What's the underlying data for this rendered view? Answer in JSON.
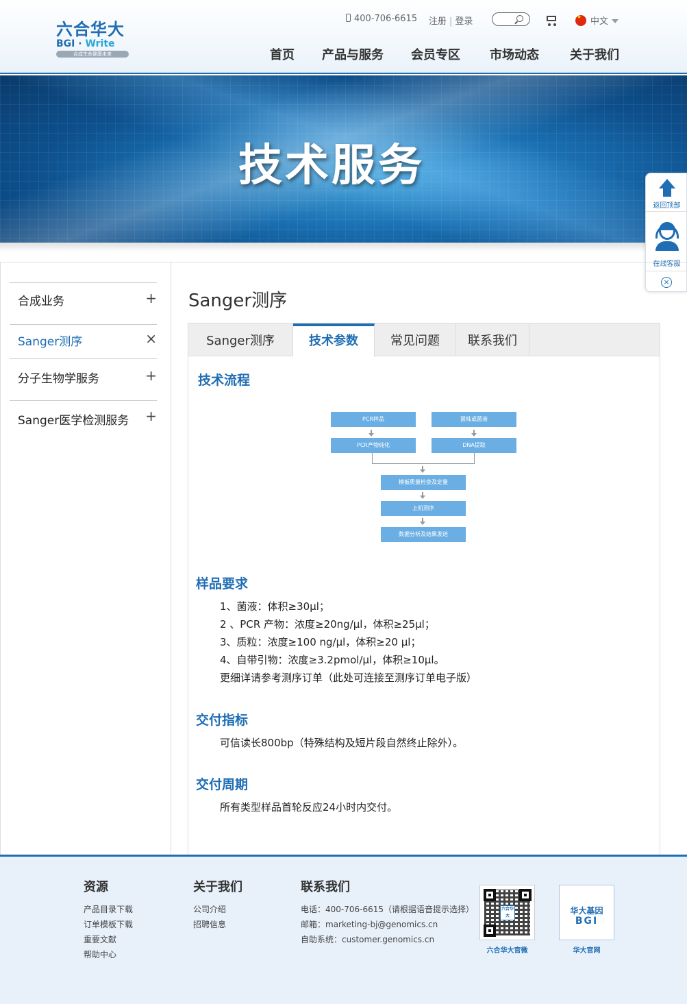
{
  "header": {
    "logo_cn": "六合华大",
    "logo_en_main": "BGI",
    "logo_en_write": "Write",
    "logo_tagline": "合成生命健康未来",
    "phone": "400-706-6615",
    "register": "注册",
    "login": "登录",
    "lang": "中文",
    "nav": [
      "首页",
      "产品与服务",
      "会员专区",
      "市场动态",
      "关于我们"
    ]
  },
  "banner": {
    "title": "技术服务"
  },
  "float_panel": {
    "back_top": "返回顶部",
    "online_service": "在线客服"
  },
  "sidebar": {
    "items": [
      {
        "label": "合成业务",
        "sign": "+"
      },
      {
        "label": "Sanger测序",
        "sign": "×",
        "active": true
      },
      {
        "label": "分子生物学服务",
        "sign": "+"
      },
      {
        "label": "Sanger医学检测服务",
        "sign": "+"
      }
    ]
  },
  "main": {
    "page_title": "Sanger测序",
    "tabs": [
      "Sanger测序",
      "技术参数",
      "常见问题",
      "联系我们"
    ],
    "active_tab": "技术参数",
    "sections": {
      "process_title": "技术流程",
      "flow": {
        "left_1": "PCR样品",
        "left_2": "PCR产物纯化",
        "right_1": "菌株或菌液",
        "right_2": "DNA提取",
        "step_1": "模板质量检查及定量",
        "step_2": "上机测序",
        "step_3": "数据分析及结果发送"
      },
      "sample_title": "样品要求",
      "sample_lines": [
        "1、菌液：体积≥30μl；",
        "2 、PCR 产物：浓度≥20ng/μl，体积≥25μl；",
        "3、质粒：浓度≥100 ng/μl，体积≥20 μl；",
        "4、自带引物：浓度≥3.2pmol/μl，体积≥10μl。",
        "更细详请参考测序订单（此处可连接至测序订单电子版）"
      ],
      "delivery_title": "交付指标",
      "delivery_text": "可信读长800bp（特殊结构及短片段自然终止除外）。",
      "cycle_title": "交付周期",
      "cycle_text": "所有类型样品首轮反应24小时内交付。"
    }
  },
  "footer": {
    "resources": {
      "title": "资源",
      "links": [
        "产品目录下载",
        "订单模板下载",
        "重要文献",
        "帮助中心"
      ]
    },
    "about": {
      "title": "关于我们",
      "links": [
        "公司介绍",
        "招聘信息"
      ]
    },
    "contact": {
      "title": "联系我们",
      "lines": [
        "电话：400-706-6615（请根据语音提示选择）",
        "邮箱：marketing-bj@genomics.cn",
        "自助系统：customer.genomics.cn"
      ]
    },
    "qr_center": "六合华大",
    "qr_caption": "六合华大官微",
    "bgi_cn": "华大基因",
    "bgi_en": "BGI",
    "bgi_caption": "华大官网"
  },
  "colors": {
    "brand_blue": "#1f6db3",
    "flow_box": "#6aaee3"
  }
}
